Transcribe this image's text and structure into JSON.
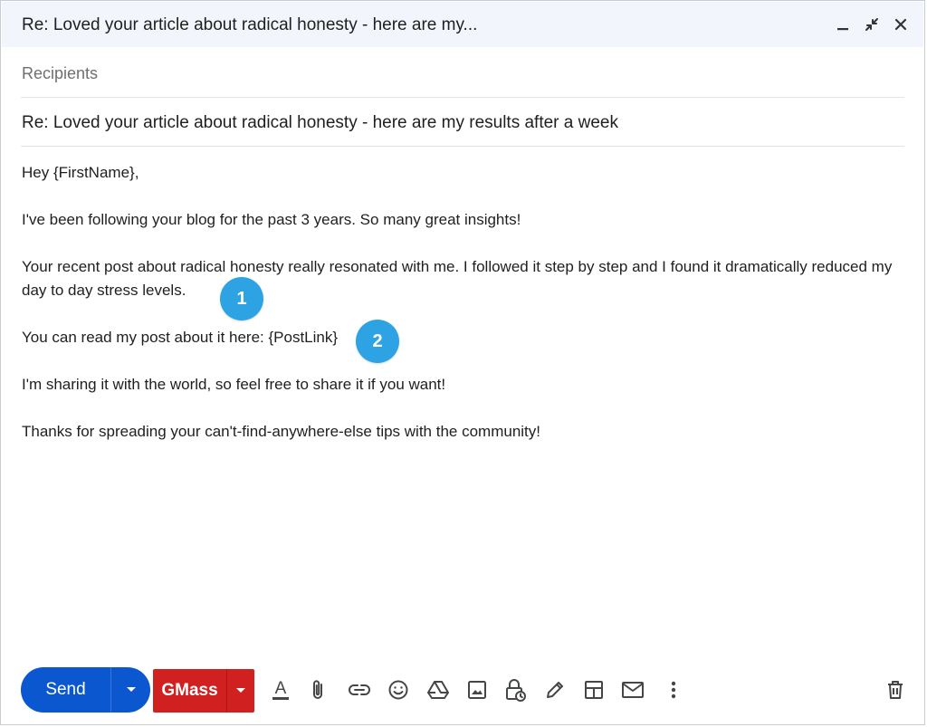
{
  "header": {
    "title": "Re: Loved your article about radical honesty - here are my...",
    "icons": [
      "minimize-icon",
      "exit-fullscreen-icon",
      "close-icon"
    ]
  },
  "compose": {
    "recipients_placeholder": "Recipients",
    "subject": "Re: Loved your article about radical honesty - here are my results after a week",
    "body": [
      "Hey {FirstName},",
      "I've been following your blog for the past 3 years. So many great insights!",
      "Your recent post about radical honesty really resonated with me. I followed it step by step and I found it dramatically reduced my day to day stress levels.",
      "You can read my post about it here: {PostLink}",
      "I'm sharing it with the world, so feel free to share it if you want!",
      "Thanks for spreading your can't-find-anywhere-else tips with the community!"
    ]
  },
  "annotations": [
    "1",
    "2"
  ],
  "toolbar": {
    "send_label": "Send",
    "gmass_label": "GMass",
    "format_glyph": "A",
    "icons": [
      "format-text-icon",
      "attach-icon",
      "link-icon",
      "emoji-icon",
      "drive-icon",
      "photo-icon",
      "confidential-lock-icon",
      "signature-pen-icon",
      "layout-icon",
      "template-email-icon",
      "more-options-icon",
      "trash-icon"
    ]
  },
  "colors": {
    "send": "#0b57d0",
    "gmass": "#d0201f",
    "badge": "#2ea3e3",
    "header_bg": "#f2f6fc"
  }
}
